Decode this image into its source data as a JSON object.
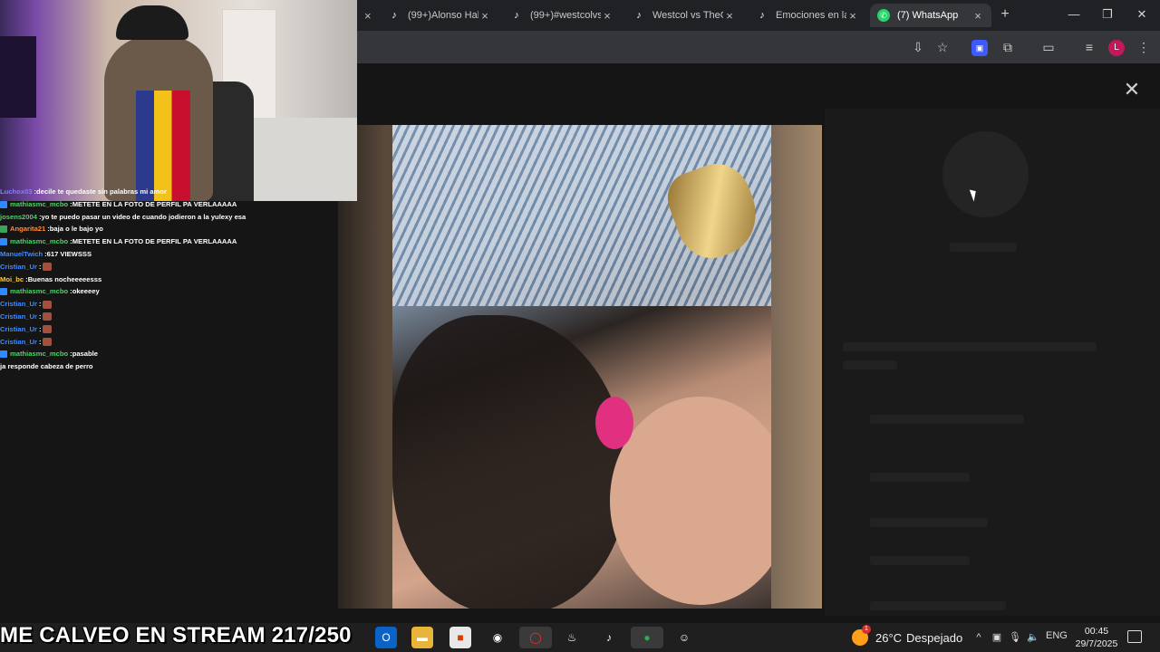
{
  "browser": {
    "tabs": [
      {
        "title": "",
        "icon": "tiktok-icon"
      },
      {
        "title": "(99+)Alonso Hab",
        "icon": "tiktok-icon"
      },
      {
        "title": "(99+)#westcolvs",
        "icon": "tiktok-icon"
      },
      {
        "title": "Westcol vs TheGr",
        "icon": "tiktok-icon"
      },
      {
        "title": "Emociones en la",
        "icon": "tiktok-icon"
      },
      {
        "title": "(7) WhatsApp",
        "icon": "whatsapp-icon",
        "active": true
      }
    ],
    "new_tab": "+",
    "close_glyph": "×",
    "window": {
      "minimize": "—",
      "restore": "❐",
      "close": "✕"
    },
    "profile_initial": "L"
  },
  "viewer": {
    "close_glyph": "✕"
  },
  "stream": {
    "overlay_title": "ME CALVEO EN STREAM 217/250",
    "chat": [
      {
        "user": "Luchox03",
        "message": "decile te quedaste sin palabras mi amor",
        "user_color": "#8a7cff",
        "badge": ""
      },
      {
        "user": "mathiasmc_mcbo",
        "message": "METETE EN LA FOTO DE PERFIL PA VERLAAAAA",
        "user_color": "#4fd16b",
        "badge": "sub"
      },
      {
        "user": "josens2004",
        "message": "yo te puedo pasar un video de cuando jodieron a la yulexy esa",
        "user_color": "#4fd16b",
        "badge": ""
      },
      {
        "user": "Angarita21",
        "message": "baja o le bajo yo",
        "user_color": "#ff8a3d",
        "badge": "vip"
      },
      {
        "user": "mathiasmc_mcbo",
        "message": "METETE EN LA FOTO DE PERFIL PA VERLAAAAA",
        "user_color": "#4fd16b",
        "badge": "sub"
      },
      {
        "user": "ManuelTwich",
        "message": "617 VIEWSSS",
        "user_color": "#3f8cff",
        "badge": ""
      },
      {
        "user": "Cristian_Ur",
        "message": "",
        "user_color": "#3f8cff",
        "badge": "",
        "emote": true
      },
      {
        "user": "Moi_bc",
        "message": "Buenas nocheeeeesss",
        "user_color": "#ffcc33",
        "badge": ""
      },
      {
        "user": "mathiasmc_mcbo",
        "message": "okeeeey",
        "user_color": "#4fd16b",
        "badge": "sub"
      },
      {
        "user": "Cristian_Ur",
        "message": "",
        "user_color": "#3f8cff",
        "badge": "",
        "emote": true
      },
      {
        "user": "Cristian_Ur",
        "message": "",
        "user_color": "#3f8cff",
        "badge": "",
        "emote": true
      },
      {
        "user": "Cristian_Ur",
        "message": "",
        "user_color": "#3f8cff",
        "badge": "",
        "emote": true
      },
      {
        "user": "Cristian_Ur",
        "message": "",
        "user_color": "#3f8cff",
        "badge": "",
        "emote": true
      },
      {
        "user": "mathiasmc_mcbo",
        "message": "pasable",
        "user_color": "#4fd16b",
        "badge": "sub"
      },
      {
        "user": "",
        "message": "ja responde cabeza de perro",
        "user_color": "#ffffff",
        "badge": ""
      }
    ]
  },
  "taskbar": {
    "weather": {
      "temp": "26°C",
      "condition": "Despejado"
    },
    "language": "ENG",
    "time": "00:45",
    "date": "29/7/2025"
  },
  "colors": {
    "accent_whatsapp": "#25d366",
    "profile": "#c2185b",
    "extension": "#3d5afe"
  }
}
